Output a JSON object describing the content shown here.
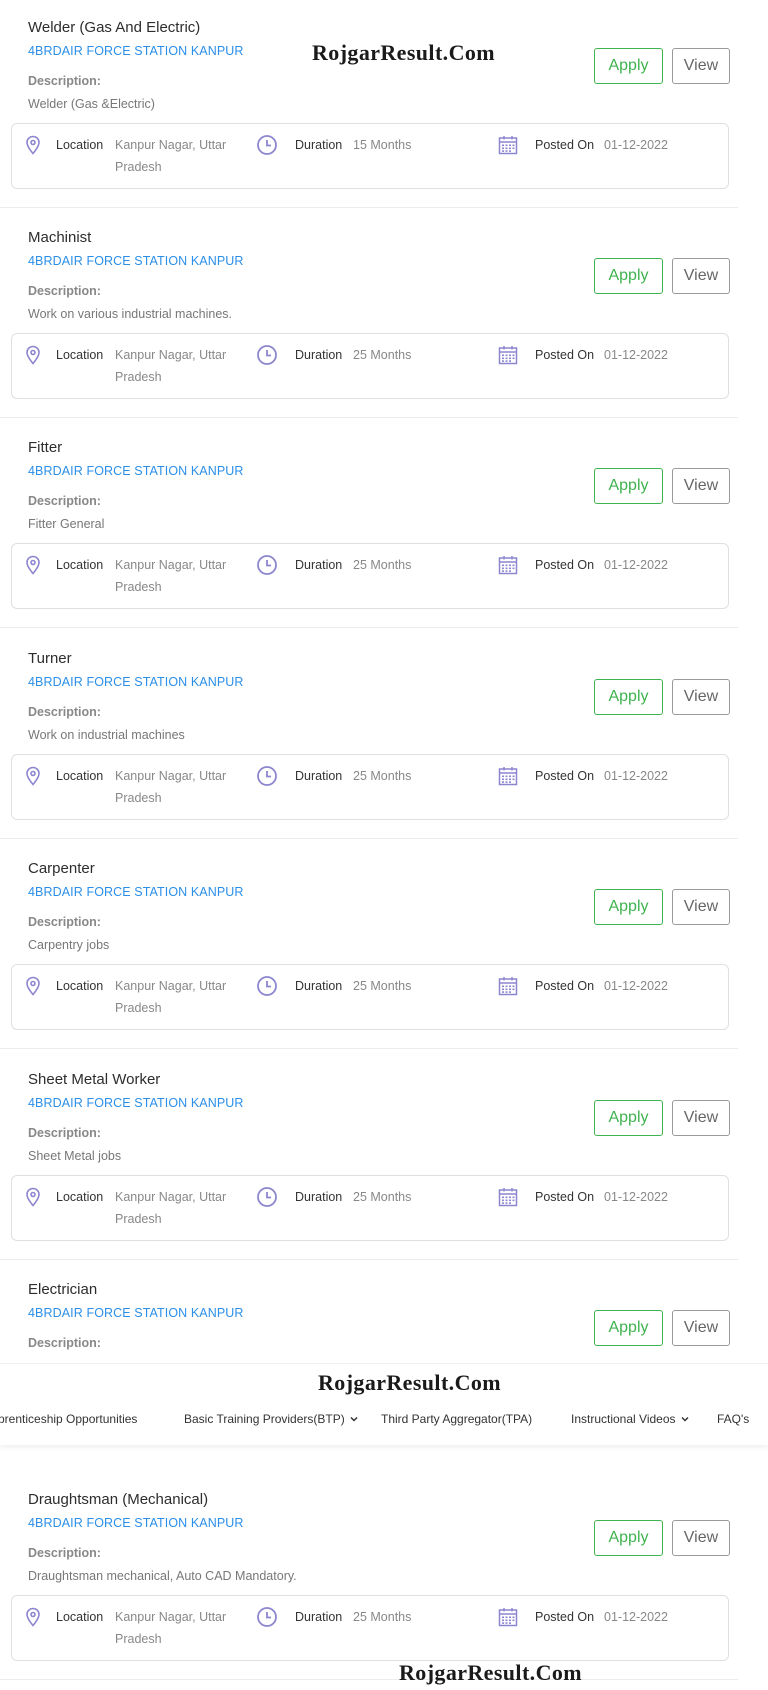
{
  "watermark": "RojgarResult.Com",
  "labels": {
    "description": "Description:",
    "location": "Location",
    "duration": "Duration",
    "posted_on": "Posted On",
    "apply": "Apply",
    "view": "View"
  },
  "jobs": [
    {
      "title": "Welder (Gas And Electric)",
      "org": "4BRDAIR FORCE STATION KANPUR",
      "description": "Welder (Gas &Electric)",
      "location": "Kanpur Nagar, Uttar Pradesh",
      "duration": "15 Months",
      "posted_on": "01-12-2022"
    },
    {
      "title": "Machinist",
      "org": "4BRDAIR FORCE STATION KANPUR",
      "description": "Work on various industrial machines.",
      "location": "Kanpur Nagar, Uttar Pradesh",
      "duration": "25 Months",
      "posted_on": "01-12-2022"
    },
    {
      "title": "Fitter",
      "org": "4BRDAIR FORCE STATION KANPUR",
      "description": "Fitter General",
      "location": "Kanpur Nagar, Uttar Pradesh",
      "duration": "25 Months",
      "posted_on": "01-12-2022"
    },
    {
      "title": "Turner",
      "org": "4BRDAIR FORCE STATION KANPUR",
      "description": "Work on industrial machines",
      "location": "Kanpur Nagar, Uttar Pradesh",
      "duration": "25 Months",
      "posted_on": "01-12-2022"
    },
    {
      "title": "Carpenter",
      "org": "4BRDAIR FORCE STATION KANPUR",
      "description": "Carpentry jobs",
      "location": "Kanpur Nagar, Uttar Pradesh",
      "duration": "25 Months",
      "posted_on": "01-12-2022"
    },
    {
      "title": "Sheet Metal Worker",
      "org": "4BRDAIR FORCE STATION KANPUR",
      "description": "Sheet Metal jobs",
      "location": "Kanpur Nagar, Uttar Pradesh",
      "duration": "25 Months",
      "posted_on": "01-12-2022"
    },
    {
      "title": "Electrician",
      "org": "4BRDAIR FORCE STATION KANPUR",
      "description": "",
      "location": "",
      "duration": "",
      "posted_on": ""
    },
    {
      "title": "Draughtsman (Mechanical)",
      "org": "4BRDAIR FORCE STATION KANPUR",
      "description": "Draughtsman mechanical, Auto CAD Mandatory.",
      "location": "Kanpur Nagar, Uttar Pradesh",
      "duration": "25 Months",
      "posted_on": "01-12-2022"
    }
  ],
  "nav": {
    "items": [
      {
        "label": "prenticeship Opportunities",
        "has_dropdown": false
      },
      {
        "label": "Basic Training Providers(BTP)",
        "has_dropdown": true
      },
      {
        "label": "Third Party Aggregator(TPA)",
        "has_dropdown": false
      },
      {
        "label": "Instructional Videos",
        "has_dropdown": true
      },
      {
        "label": "FAQ's",
        "has_dropdown": false
      }
    ]
  },
  "colors": {
    "org_link": "#2b8fe8",
    "apply": "#3fb34f",
    "icon": "#8c86cf"
  }
}
